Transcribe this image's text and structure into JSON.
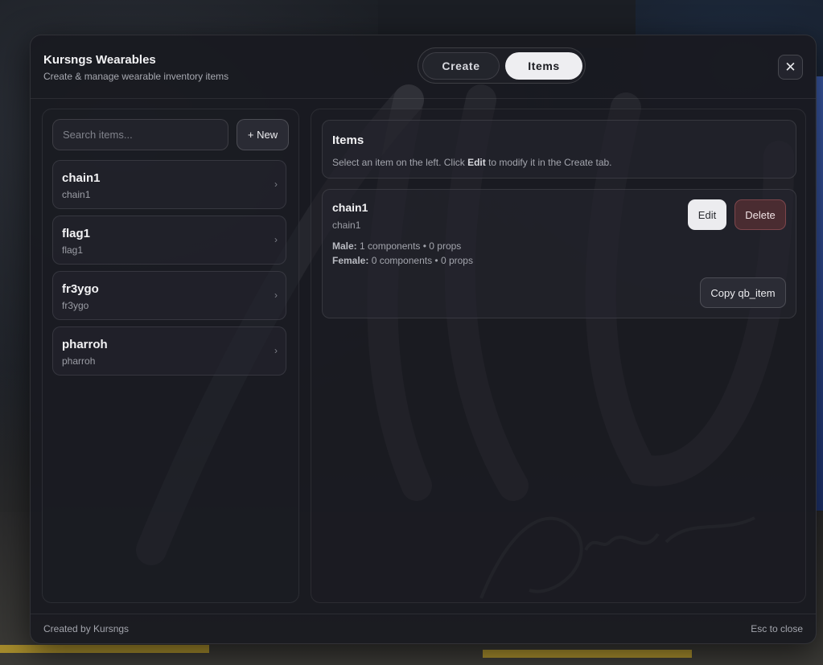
{
  "header": {
    "title": "Kursngs Wearables",
    "subtitle": "Create & manage wearable inventory items",
    "tabs": [
      {
        "label": "Create",
        "active": false
      },
      {
        "label": "Items",
        "active": true
      }
    ],
    "close_icon": "close-icon",
    "close_glyph": "✕"
  },
  "sidebar": {
    "search": {
      "placeholder": "Search items...",
      "value": ""
    },
    "new_label": "+ New",
    "items": [
      {
        "name": "chain1",
        "id": "chain1"
      },
      {
        "name": "flag1",
        "id": "flag1"
      },
      {
        "name": "fr3ygo",
        "id": "fr3ygo"
      },
      {
        "name": "pharroh",
        "id": "pharroh"
      }
    ],
    "chevron_glyph": "›"
  },
  "main": {
    "info": {
      "title": "Items",
      "text_before": "Select an item on the left. Click ",
      "text_bold": "Edit",
      "text_after": " to modify it in the Create tab."
    },
    "detail": {
      "name": "chain1",
      "id": "chain1",
      "male_label": "Male:",
      "male_value": "1 components • 0 props",
      "female_label": "Female:",
      "female_value": "0 components • 0 props",
      "edit_label": "Edit",
      "delete_label": "Delete",
      "copy_label": "Copy qb_item"
    }
  },
  "footer": {
    "left": "Created by Kursngs",
    "right": "Esc to close"
  },
  "colors": {
    "panel_bg": "#191a20",
    "active_tab_bg": "#eeeef1",
    "delete_bg": "#4a2c31",
    "accent_text": "#f2f2f4"
  }
}
